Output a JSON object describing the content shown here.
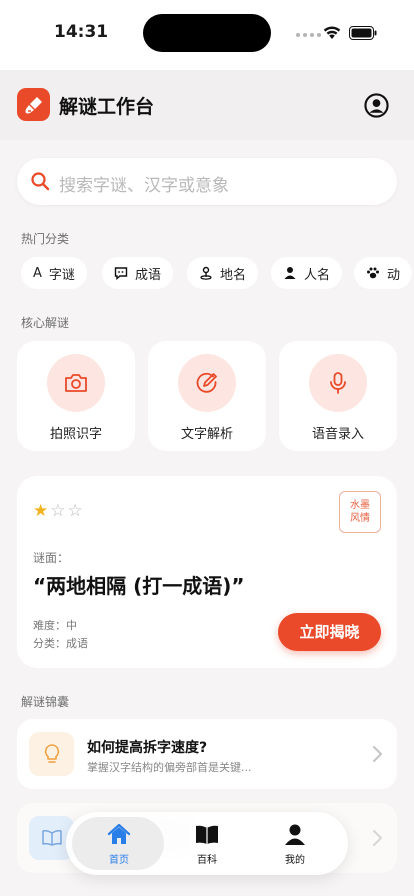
{
  "status_bar": {
    "time": "14:31"
  },
  "header": {
    "title": "解谜工作台"
  },
  "search": {
    "placeholder": "搜索字谜、汉字或意象"
  },
  "hot_categories": {
    "label": "热门分类",
    "chips": [
      {
        "icon": "letter-a-icon",
        "glyph": "A",
        "label": "字谜"
      },
      {
        "icon": "chat-bubble-icon",
        "label": "成语"
      },
      {
        "icon": "map-pin-icon",
        "label": "地名"
      },
      {
        "icon": "person-icon",
        "label": "人名"
      },
      {
        "icon": "paw-icon",
        "label": "动"
      }
    ]
  },
  "core": {
    "label": "核心解谜",
    "cards": [
      {
        "icon": "camera-icon",
        "label": "拍照识字"
      },
      {
        "icon": "edit-circle-icon",
        "label": "文字解析"
      },
      {
        "icon": "microphone-icon",
        "label": "语音录入"
      }
    ]
  },
  "riddle": {
    "rating": 1,
    "rating_max": 3,
    "stamp_lines": [
      "水墨",
      "风情"
    ],
    "prefix": "谜面：",
    "text": "“两地相隔 (打一成语)”",
    "difficulty": "难度：中",
    "category": "分类：成语",
    "action": "立即揭晓"
  },
  "tips": {
    "label": "解谜锦囊",
    "items": [
      {
        "icon": "lightbulb-icon",
        "title": "如何提高拆字速度?",
        "desc": "掌握汉字结构的偏旁部首是关键..."
      },
      {
        "icon": "book-icon"
      }
    ]
  },
  "tab_bar": {
    "tabs": [
      {
        "icon": "home-icon",
        "label": "首页",
        "active": true
      },
      {
        "icon": "book-open-icon",
        "label": "百科"
      },
      {
        "icon": "person-icon",
        "label": "我的"
      }
    ]
  },
  "colors": {
    "accent": "#ea4a2a",
    "accent_soft": "#fde6e1",
    "star": "#f2b320",
    "tab_active": "#2a7ee8"
  }
}
